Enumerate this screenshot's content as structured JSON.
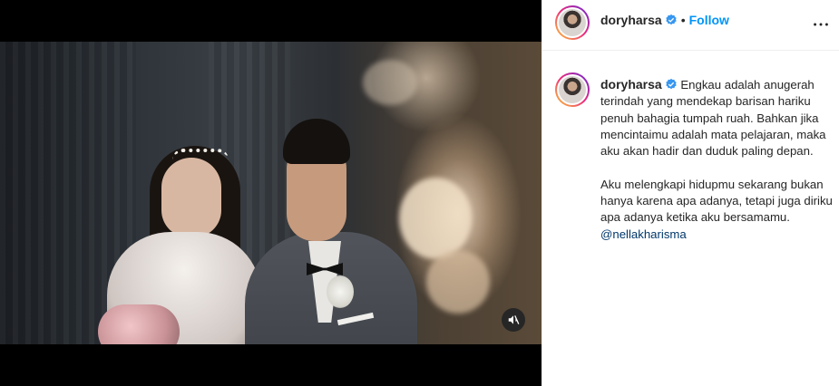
{
  "post": {
    "username": "doryharsa",
    "separator": "•",
    "follow_label": "Follow",
    "caption_lines": [
      "Engkau adalah anugerah terindah yang mendekap barisan hariku penuh bahagia tumpah ruah. Bahkan jika mencintaimu adalah mata pelajaran, maka aku akan hadir dan duduk paling depan.",
      "Aku melengkapi hidupmu sekarang bukan hanya karena apa adanya, tetapi juga diriku apa adanya ketika aku bersamamu."
    ],
    "mention": "@nellakharisma"
  },
  "media": {
    "type": "video",
    "audio_state": "muted"
  },
  "icons": {
    "verified": "verified-badge-icon",
    "more": "more-options-icon",
    "mute": "speaker-muted-icon"
  },
  "colors": {
    "accent": "#0095f6",
    "verified": "#3897f0",
    "mention": "#00376b",
    "text": "#262626"
  }
}
